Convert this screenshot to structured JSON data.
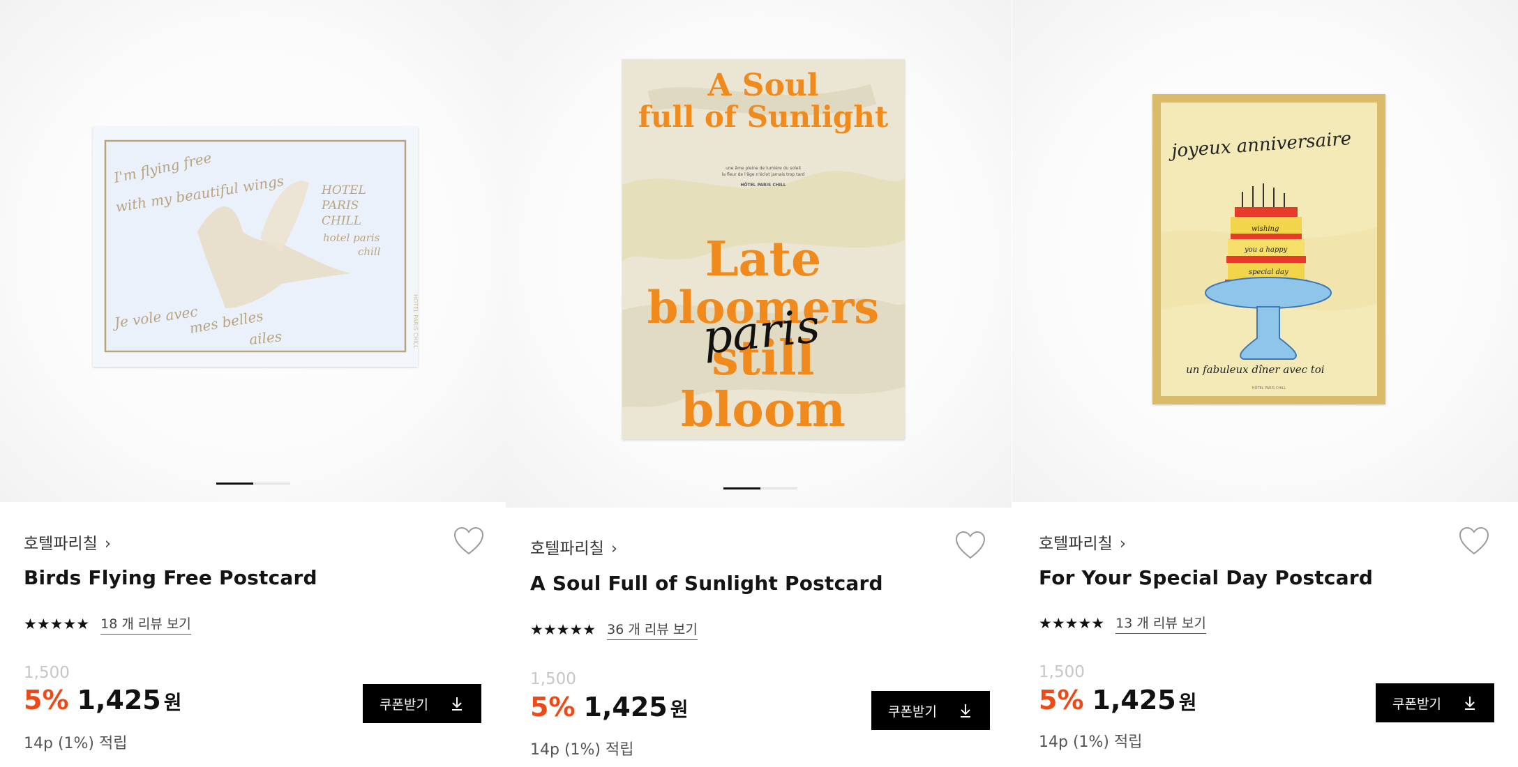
{
  "colors": {
    "discount": "#ee4a17",
    "button_bg": "#000000",
    "text": "#111111"
  },
  "products": [
    {
      "brand": "호텔파리칠",
      "brand_chevron": "›",
      "title": "Birds Flying Free Postcard",
      "stars": "★★★★★",
      "rating": 5,
      "reviews": "18 개 리뷰 보기",
      "original_price": "1,500",
      "discount": "5%",
      "price": "1,425",
      "currency": "원",
      "points": "14p (1%) 적립",
      "coupon_label": "쿠폰받기",
      "image": {
        "lines": [
          "I'm flying free",
          "with my beautiful wings"
        ],
        "brand_lines": [
          "HOTEL",
          "PARIS",
          "CHILL",
          "hotel paris",
          "chill"
        ],
        "bottom_lines": [
          "Je vole avec",
          "mes belles",
          "ailes"
        ],
        "side_text": "HÔTEL PARIS CHILL"
      },
      "carousel": {
        "count": 2,
        "active": 1
      }
    },
    {
      "brand": "호텔파리칠",
      "brand_chevron": "›",
      "title": "A Soul Full of Sunlight Postcard",
      "stars": "★★★★★",
      "rating": 5,
      "reviews": "36 개 리뷰 보기",
      "original_price": "1,500",
      "discount": "5%",
      "price": "1,425",
      "currency": "원",
      "points": "14p (1%) 적립",
      "coupon_label": "쿠폰받기",
      "image": {
        "heading": [
          "A Soul",
          "full of Sunlight"
        ],
        "small": [
          "une âme pleine de lumière du soleil",
          "la fleur de l'âge n'éclot jamais trop tard"
        ],
        "small_brand": "HÔTEL PARIS CHILL",
        "big": [
          "Late",
          "bloomers",
          "still",
          "bloom"
        ],
        "script": "paris"
      },
      "carousel": {
        "count": 2,
        "active": 1
      }
    },
    {
      "brand": "호텔파리칠",
      "brand_chevron": "›",
      "title": "For Your Special Day Postcard",
      "stars": "★★★★★",
      "rating": 5,
      "reviews": "13 개 리뷰 보기",
      "original_price": "1,500",
      "discount": "5%",
      "price": "1,425",
      "currency": "원",
      "points": "14p (1%) 적립",
      "coupon_label": "쿠폰받기",
      "image": {
        "heading": "joyeux anniversaire",
        "cake_lines": [
          "wishing",
          "you a happy",
          "special day"
        ],
        "bottom": "un fabuleux dîner avec toi",
        "small_brand": "HÔTEL PARIS CHILL"
      }
    }
  ]
}
